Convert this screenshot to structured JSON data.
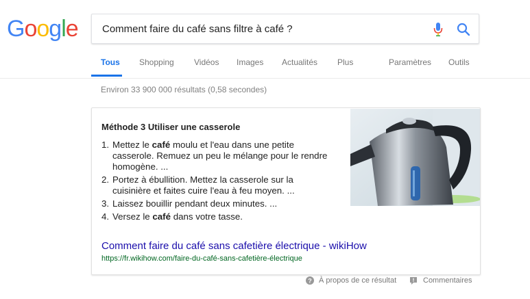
{
  "logo": {
    "letters": [
      "G",
      "o",
      "o",
      "g",
      "l",
      "e"
    ],
    "colors": [
      "#4285f4",
      "#ea4335",
      "#fbbc05",
      "#4285f4",
      "#34a853",
      "#ea4335"
    ]
  },
  "search": {
    "query": "Comment faire du café sans filtre à café ?"
  },
  "tabs": [
    {
      "label": "Tous"
    },
    {
      "label": "Shopping"
    },
    {
      "label": "Vidéos"
    },
    {
      "label": "Images"
    },
    {
      "label": "Actualités"
    },
    {
      "label": "Plus"
    },
    {
      "label": "Paramètres"
    },
    {
      "label": "Outils"
    }
  ],
  "stats": "Environ 33 900 000 résultats (0,58 secondes)",
  "snippet": {
    "title": "Méthode 3 Utiliser une casserole",
    "steps": [
      {
        "num": "1.",
        "before": "Mettez le ",
        "bold": "café",
        "after": " moulu et l'eau dans une petite casserole. Remuez un peu le mélange pour le rendre homogène. ..."
      },
      {
        "num": "2.",
        "before": "Portez à ébullition. Mettez la casserole sur la cuisinière et faites cuire l'eau à feu moyen. ...",
        "bold": "",
        "after": ""
      },
      {
        "num": "3.",
        "before": "Laissez bouillir pendant deux minutes. ...",
        "bold": "",
        "after": ""
      },
      {
        "num": "4.",
        "before": "Versez le ",
        "bold": "café",
        "after": " dans votre tasse."
      }
    ],
    "link": "Comment faire du café sans cafetière électrique - wikiHow",
    "url": "https://fr.wikihow.com/faire-du-café-sans-cafetière-électrique"
  },
  "footer": {
    "about": "À propos de ce résultat",
    "feedback": "Commentaires"
  },
  "colors": {
    "accent": "#1a73e8",
    "link": "#1a0dab",
    "url": "#006621"
  }
}
